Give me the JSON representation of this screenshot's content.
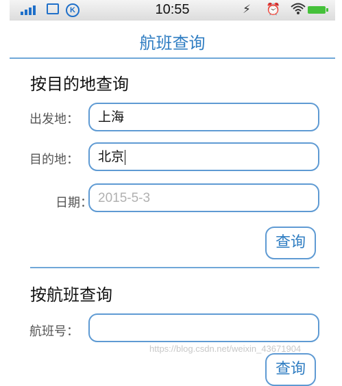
{
  "status_bar": {
    "time": "10:55",
    "k_label": "K"
  },
  "nav": {
    "title": "航班查询"
  },
  "by_destination": {
    "title": "按目的地查询",
    "departure_label": "出发地：",
    "departure_value": "上海",
    "destination_label": "目的地：",
    "destination_value": "北京",
    "date_label": "日期：",
    "date_placeholder": "2015-5-3",
    "query_button": "查询"
  },
  "by_flight": {
    "title": "按航班查询",
    "flight_no_label": "航班号：",
    "flight_no_value": "",
    "query_button": "查询"
  },
  "watermark": "https://blog.csdn.net/weixin_43671904",
  "colors": {
    "accent": "#2f7dc2",
    "border": "#5e9ad3",
    "battery": "#45c13a"
  }
}
